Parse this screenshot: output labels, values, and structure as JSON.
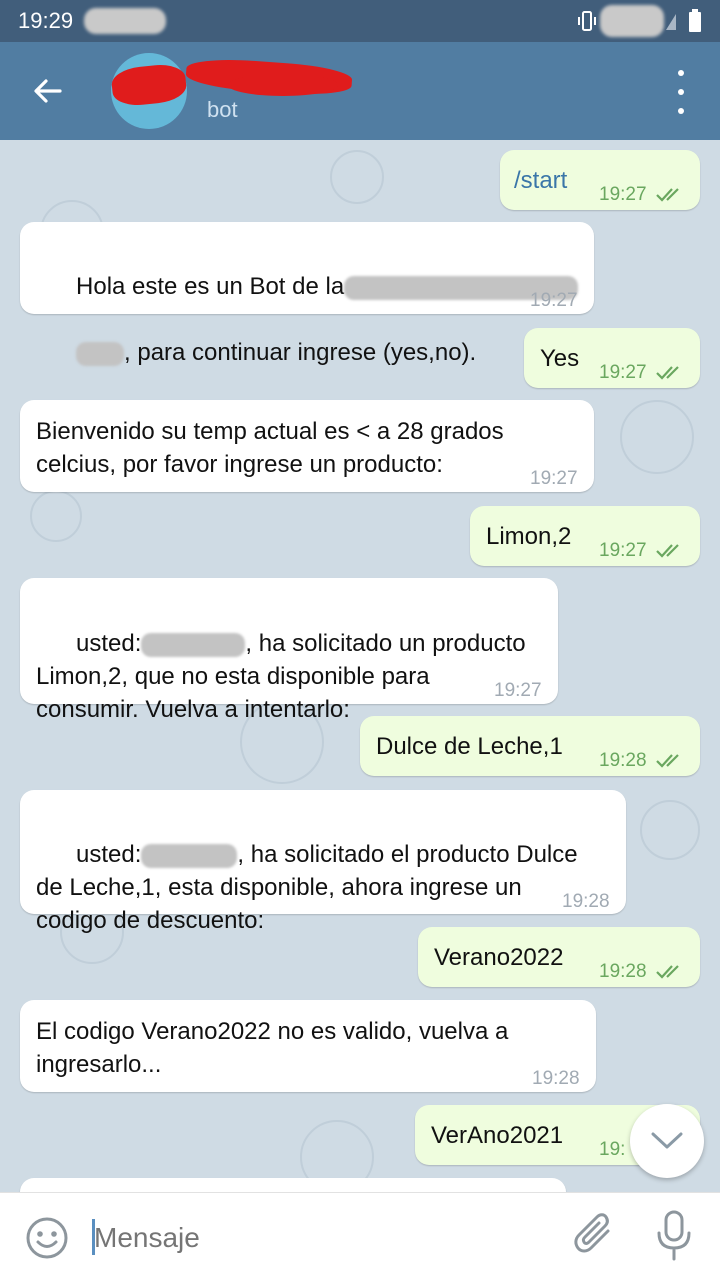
{
  "status_bar": {
    "time": "19:29"
  },
  "header": {
    "title": "",
    "subtitle": "bot"
  },
  "messages": [
    {
      "id": "m1",
      "dir": "out",
      "text": "/start",
      "time": "19:27"
    },
    {
      "id": "m2",
      "dir": "in",
      "line1_a": "Hola este es un Bot de la",
      "line2_b": ", para continuar ingrese (yes,no).",
      "time": "19:27"
    },
    {
      "id": "m3",
      "dir": "out",
      "text": "Yes",
      "time": "19:27"
    },
    {
      "id": "m4",
      "dir": "in",
      "text": "Bienvenido su temp actual es < a 28 grados\ncelcius, por favor ingrese un producto:",
      "time": "19:27"
    },
    {
      "id": "m5",
      "dir": "out",
      "text": "Limon,2",
      "time": "19:27"
    },
    {
      "id": "m6",
      "dir": "in",
      "line1_a": "usted:",
      "line1_b": ", ha solicitado un producto",
      "rest": "Limon,2, que no esta disponible para\nconsumir. Vuelva a intentarlo:",
      "time": "19:27"
    },
    {
      "id": "m7",
      "dir": "out",
      "text": "Dulce de Leche,1",
      "time": "19:28"
    },
    {
      "id": "m8",
      "dir": "in",
      "line1_a": "usted:",
      "line1_b": ", ha solicitado el producto Dulce",
      "rest": "de Leche,1, esta disponible, ahora ingrese un\ncodigo de descuento:",
      "time": "19:28"
    },
    {
      "id": "m9",
      "dir": "out",
      "text": "Verano2022",
      "time": "19:28"
    },
    {
      "id": "m10",
      "dir": "in",
      "text": "El codigo Verano2022 no es valido, vuelva a\ningresarlo...",
      "time": "19:28"
    },
    {
      "id": "m11",
      "dir": "out",
      "text": "VerAno2021",
      "time": "19:"
    }
  ],
  "input": {
    "placeholder": "Mensaje"
  },
  "icons": {
    "back": "arrow-left-icon",
    "menu": "more-vertical-icon",
    "emoji": "smiley-icon",
    "attach": "paperclip-icon",
    "mic": "microphone-icon",
    "scroll": "chevron-down-icon",
    "read": "double-check-icon"
  },
  "colors": {
    "header": "#517da2",
    "statusbar": "#415e7b",
    "chat_bg": "#cfdbe4",
    "outgoing_bubble": "#effdde",
    "incoming_bubble": "#ffffff",
    "out_time": "#6aa75f",
    "in_time": "#a1aab3"
  }
}
